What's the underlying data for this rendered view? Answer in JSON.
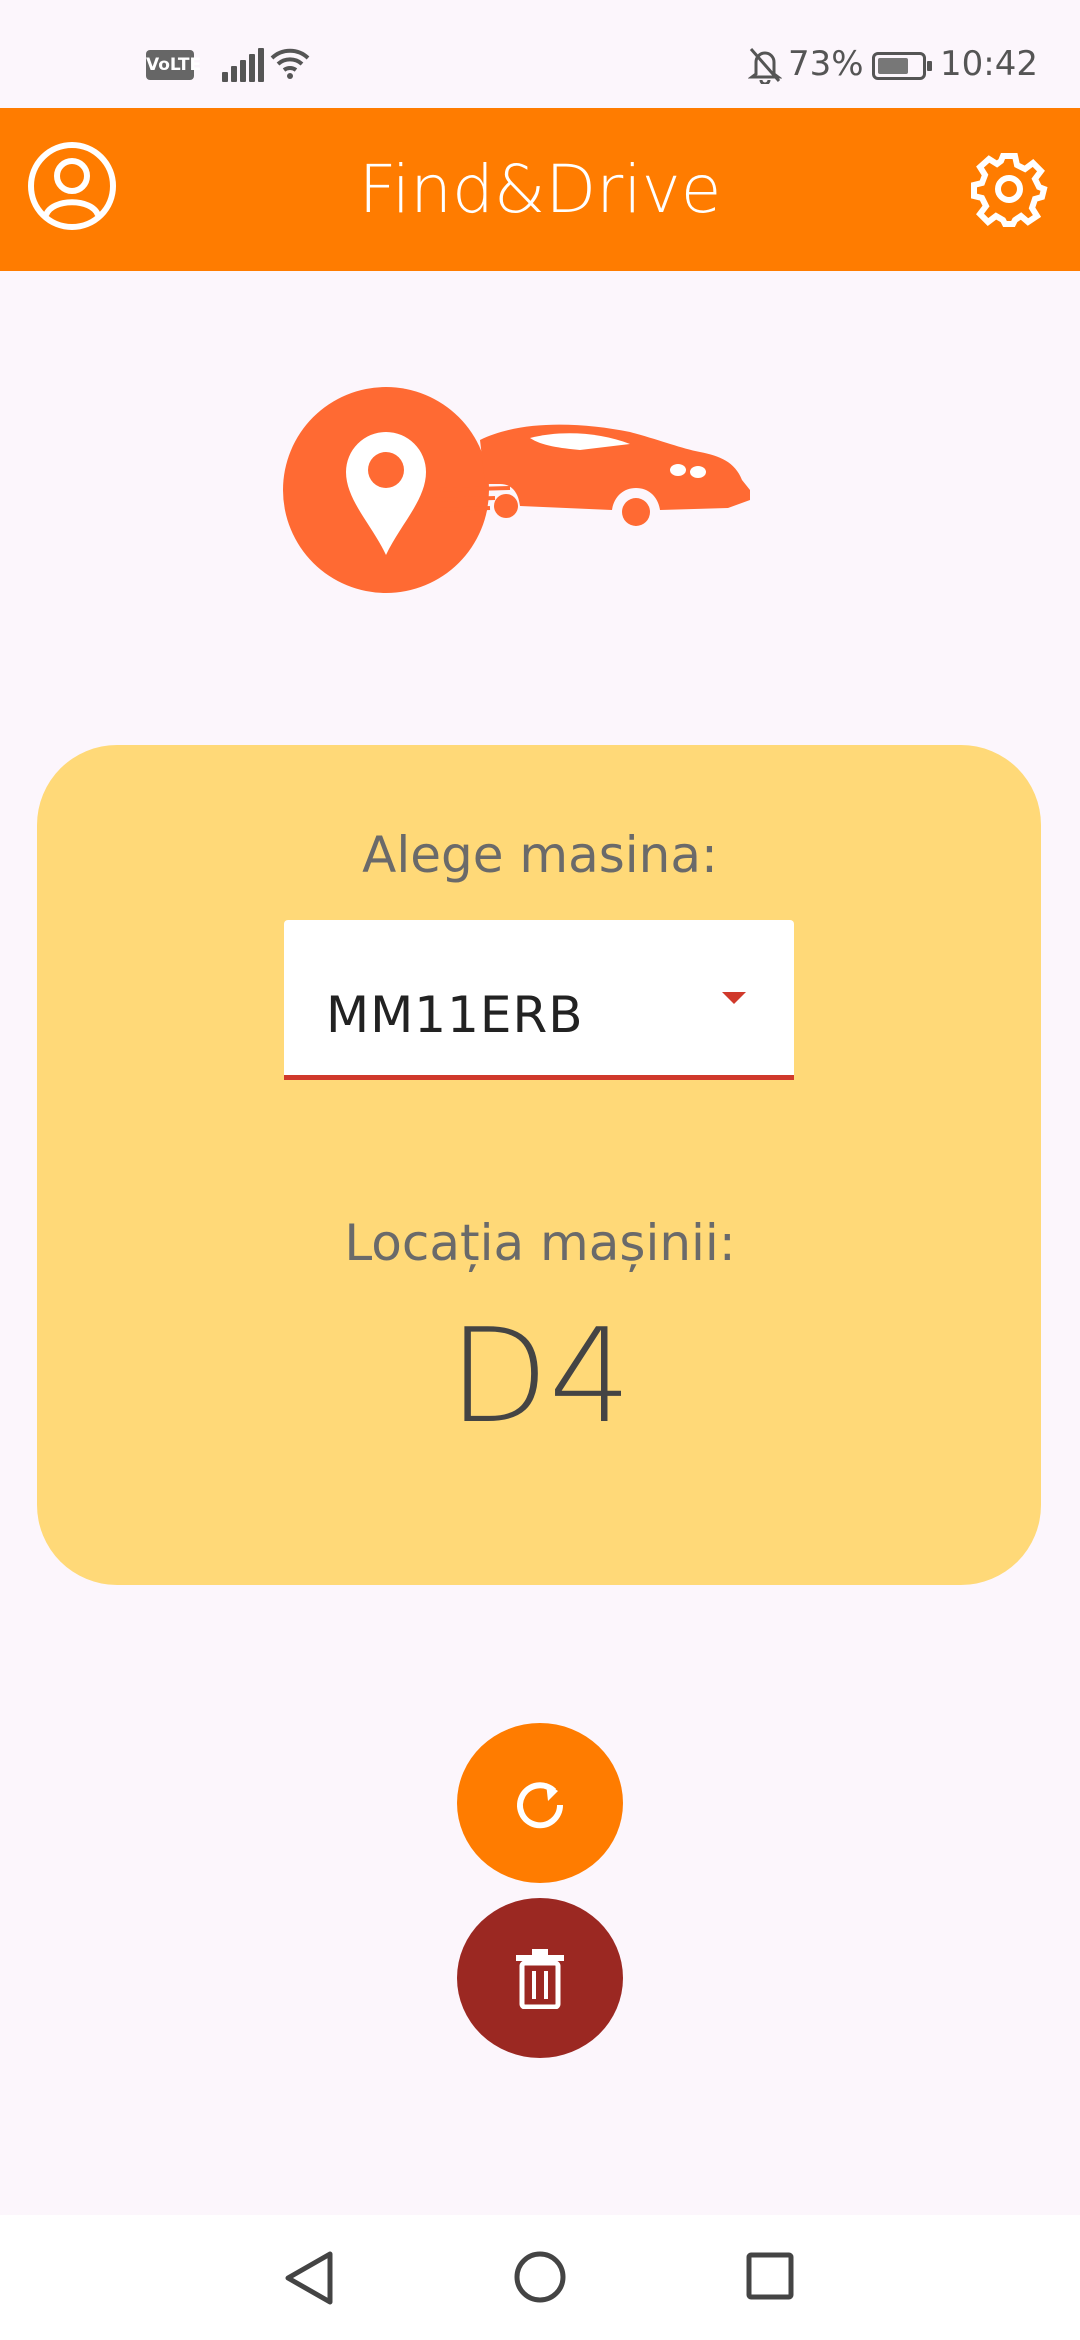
{
  "status_bar": {
    "network_badge": "VoLTE",
    "battery_percent": "73%",
    "time": "10:42",
    "icons": [
      "signal-icon",
      "wifi-icon",
      "bell-off-icon",
      "battery-icon"
    ]
  },
  "app_bar": {
    "title": "Find&Drive",
    "left_icon": "profile-icon",
    "right_icon": "gear-icon",
    "color": "#FF7C00"
  },
  "logo": {
    "icons": [
      "location-pin-icon",
      "car-icon"
    ],
    "color": "#FF6A33"
  },
  "card": {
    "choose_label": "Alege masina:",
    "selected_car": "MM11ERB",
    "location_label": "Locația mașinii:",
    "location_value": "D4",
    "color": "#FFD978"
  },
  "actions": {
    "refresh_icon": "refresh-icon",
    "refresh_color": "#FF7C00",
    "delete_icon": "trash-icon",
    "delete_color": "#9B2822"
  },
  "nav_bar": {
    "icons": [
      "back-icon",
      "home-icon",
      "recents-icon"
    ]
  }
}
